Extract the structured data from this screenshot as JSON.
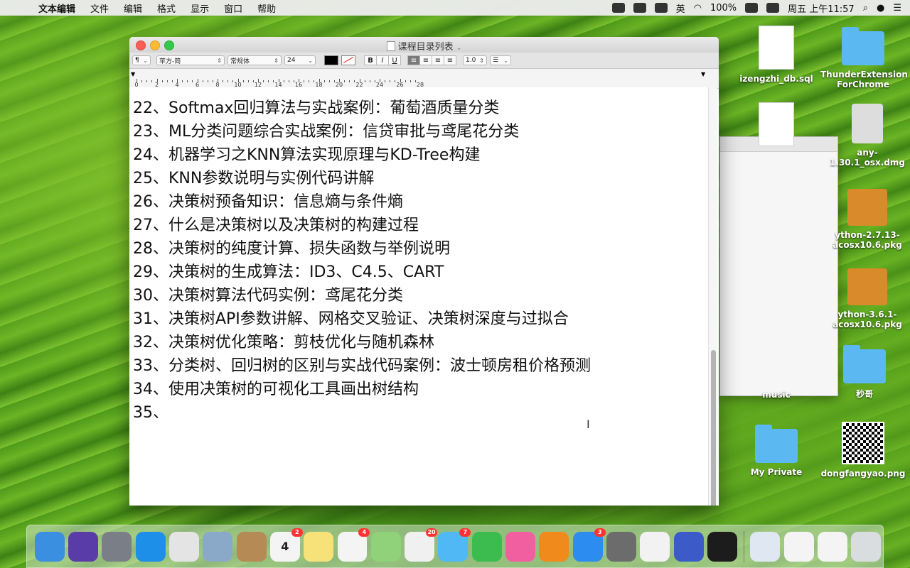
{
  "menubar": {
    "app_name": "文本编辑",
    "items": [
      "文件",
      "编辑",
      "格式",
      "显示",
      "窗口",
      "帮助"
    ],
    "battery": "100%",
    "clock": "周五 上午11:57",
    "input_method": "英"
  },
  "desktop_icons": [
    {
      "label": "izengzhi_db.sql",
      "type": "doc"
    },
    {
      "label": "ThunderExtension ForChrome",
      "type": "folder"
    },
    {
      "label": "any-1.30.1_osx.dmg",
      "type": "dmg"
    },
    {
      "label": "ython-2.7.13-acosx10.6.pkg",
      "type": "pkg"
    },
    {
      "label": "ython-3.6.1-acosx10.6.pkg",
      "type": "pkg"
    },
    {
      "label": "秒哥",
      "type": "folder"
    },
    {
      "label": "music",
      "type": "folder"
    },
    {
      "label": "My Private",
      "type": "folder"
    },
    {
      "label": "dongfangyao.png",
      "type": "qr"
    }
  ],
  "window": {
    "title": "课程目录列表",
    "toolbar": {
      "paragraph_style": "¶",
      "font_family": "苹方-简",
      "font_style": "常规体",
      "font_size": "24",
      "bold": "B",
      "italic": "I",
      "underline": "U",
      "line_spacing": "1.0"
    },
    "ruler_numbers": [
      "0",
      "2",
      "4",
      "6",
      "8",
      "10",
      "12",
      "14",
      "16",
      "18",
      "20",
      "22",
      "24",
      "26",
      "28"
    ],
    "lines": [
      "22、Softmax回归算法与实战案例：葡萄酒质量分类",
      "23、ML分类问题综合实战案例：信贷审批与鸢尾花分类",
      "24、机器学习之KNN算法实现原理与KD-Tree构建",
      "25、KNN参数说明与实例代码讲解",
      "26、决策树预备知识：信息熵与条件熵",
      "27、什么是决策树以及决策树的构建过程",
      "28、决策树的纯度计算、损失函数与举例说明",
      "29、决策树的生成算法：ID3、C4.5、CART",
      "30、决策树算法代码实例：鸢尾花分类",
      "31、决策树API参数讲解、网格交叉验证、决策树深度与过拟合",
      "32、决策树优化策略：剪枝优化与随机森林",
      "33、分类树、回归树的区别与实战代码案例：波士顿房租价格预测",
      "34、使用决策树的可视化工具画出树结构",
      "35、"
    ]
  },
  "dock": {
    "apps": [
      {
        "name": "finder-icon",
        "color": "#3b8fe0"
      },
      {
        "name": "siri-icon",
        "color": "#5a3ca8"
      },
      {
        "name": "launchpad-icon",
        "color": "#7a7f87"
      },
      {
        "name": "safari-icon",
        "color": "#1e8fe8"
      },
      {
        "name": "chrome-icon",
        "color": "#e4e4e4"
      },
      {
        "name": "preview-icon",
        "color": "#8aa9c9"
      },
      {
        "name": "contacts-icon",
        "color": "#b58a55"
      },
      {
        "name": "calendar-icon",
        "color": "#f4f4f4",
        "badge": "2",
        "text": "4"
      },
      {
        "name": "notes-icon",
        "color": "#f7e27a"
      },
      {
        "name": "reminders-icon",
        "color": "#f4f4f4",
        "badge": "4"
      },
      {
        "name": "maps-icon",
        "color": "#8fd27a"
      },
      {
        "name": "photos-icon",
        "color": "#f0f0f0",
        "badge": "20"
      },
      {
        "name": "messages-icon",
        "color": "#4fb8f5",
        "badge": "7"
      },
      {
        "name": "facetime-icon",
        "color": "#3cbc4e"
      },
      {
        "name": "itunes-icon",
        "color": "#f25fa0"
      },
      {
        "name": "ibooks-icon",
        "color": "#f08a1c"
      },
      {
        "name": "appstore-icon",
        "color": "#2d8cf0",
        "badge": "3"
      },
      {
        "name": "system-preferences-icon",
        "color": "#6c6c6c"
      },
      {
        "name": "textedit-icon",
        "color": "#f2f2f2"
      },
      {
        "name": "screen-recorder-icon",
        "color": "#3d5bc8"
      },
      {
        "name": "terminal-icon",
        "color": "#1c1c1c"
      },
      {
        "name": "bt-downloads-icon",
        "color": "#dfe8f2"
      },
      {
        "name": "document-thumbnail-icon",
        "color": "#f4f4f4"
      },
      {
        "name": "chrome-window-thumbnail-icon",
        "color": "#f4f4f4"
      },
      {
        "name": "trash-icon",
        "color": "#d9dde0"
      }
    ]
  }
}
